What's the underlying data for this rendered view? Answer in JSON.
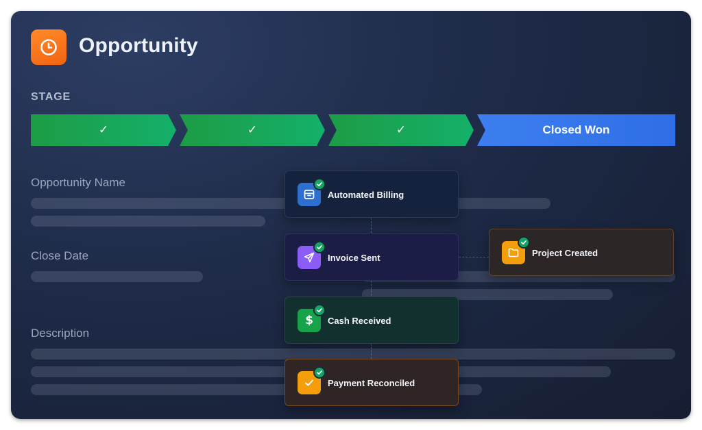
{
  "header": {
    "title": "Opportunity",
    "icon": "clock-icon",
    "accent": "#f26411"
  },
  "stage": {
    "label": "STAGE",
    "steps": [
      {
        "label": "✓",
        "state": "done"
      },
      {
        "label": "✓",
        "state": "done"
      },
      {
        "label": "✓",
        "state": "done"
      },
      {
        "label": "Closed Won",
        "state": "current"
      }
    ],
    "done_color": "#1d9c45",
    "current_color": "#2f6ee6"
  },
  "fields": {
    "opportunity_name": "Opportunity Name",
    "close_date": "Close Date",
    "description": "Description"
  },
  "workflow": {
    "automated_billing": {
      "label": "Automated Billing",
      "icon": "archive-icon",
      "color": "#2f6fd0"
    },
    "invoice_sent": {
      "label": "Invoice Sent",
      "icon": "send-icon",
      "color": "#8b5cf6"
    },
    "cash_received": {
      "label": "Cash Received",
      "icon": "dollar-icon",
      "color": "#16a34a"
    },
    "payment_reconciled": {
      "label": "Payment Reconciled",
      "icon": "check-square-icon",
      "color": "#f59e0b"
    },
    "project_created": {
      "label": "Project Created",
      "icon": "folder-icon",
      "color": "#f59e0b"
    }
  }
}
